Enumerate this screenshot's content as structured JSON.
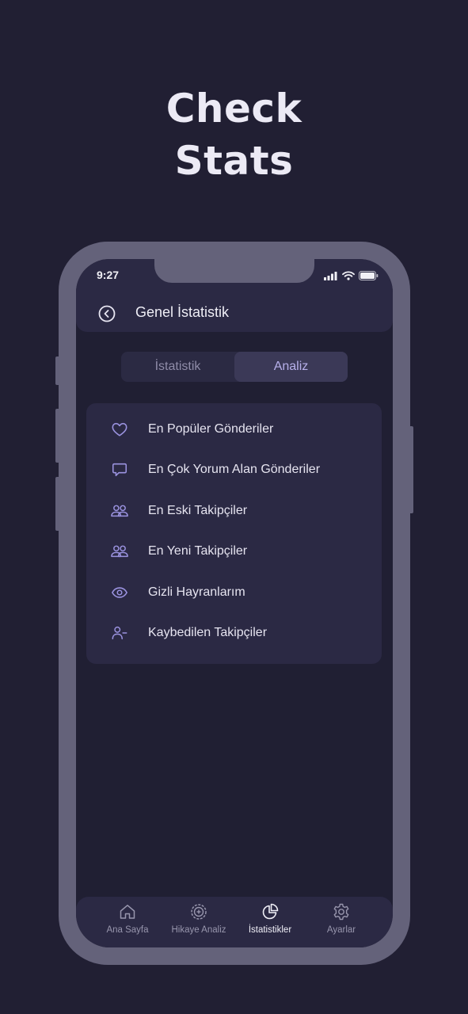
{
  "headline": {
    "line1": "Check",
    "line2": "Stats"
  },
  "status_bar": {
    "time": "9:27"
  },
  "appbar": {
    "title": "Genel İstatistik",
    "back_icon": "chevron-left-circle-icon"
  },
  "segment": {
    "tabs": [
      {
        "label": "İstatistik",
        "active": false
      },
      {
        "label": "Analiz",
        "active": true
      }
    ]
  },
  "menu": {
    "items": [
      {
        "label": "En Popüler Gönderiler",
        "icon": "heart-icon"
      },
      {
        "label": "En Çok Yorum Alan Gönderiler",
        "icon": "comment-icon"
      },
      {
        "label": "En Eski Takipçiler",
        "icon": "users-icon"
      },
      {
        "label": "En Yeni Takipçiler",
        "icon": "users-icon"
      },
      {
        "label": "Gizli Hayranlarım",
        "icon": "eye-icon"
      },
      {
        "label": "Kaybedilen Takipçiler",
        "icon": "user-minus-icon"
      }
    ]
  },
  "tabbar": {
    "items": [
      {
        "label": "Ana Sayfa",
        "icon": "home-icon",
        "active": false
      },
      {
        "label": "Hikaye Analiz",
        "icon": "plus-circle-icon",
        "active": false
      },
      {
        "label": "İstatistikler",
        "icon": "pie-chart-icon",
        "active": true
      },
      {
        "label": "Ayarlar",
        "icon": "gear-icon",
        "active": false
      }
    ]
  },
  "colors": {
    "background": "#211f33",
    "phone_frame": "#64627a",
    "surface": "#2b2944",
    "accent": "#b7b0ea",
    "icon_purple": "#9b93e0"
  }
}
